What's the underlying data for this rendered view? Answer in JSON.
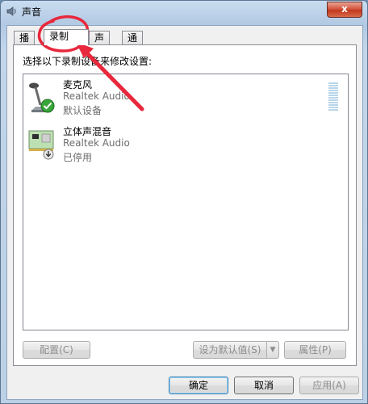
{
  "window": {
    "title": "声音",
    "close_glyph": "x"
  },
  "tabs": [
    {
      "label": "播放",
      "active": false
    },
    {
      "label": "录制",
      "active": true
    },
    {
      "label": "声音",
      "active": false
    },
    {
      "label": "通信",
      "active": false
    }
  ],
  "panel": {
    "instruction": "选择以下录制设备来修改设置:",
    "devices": [
      {
        "name": "麦克风",
        "driver": "Realtek Audio",
        "status": "默认设备",
        "icon": "microphone-icon",
        "badge": "default-check-icon"
      },
      {
        "name": "立体声混音",
        "driver": "Realtek Audio",
        "status": "已停用",
        "icon": "sound-card-icon",
        "badge": "disabled-arrow-icon"
      }
    ]
  },
  "panel_buttons": {
    "configure": "配置(C)",
    "set_default": "设为默认值(S)",
    "properties": "属性(P)"
  },
  "dialog_buttons": {
    "ok": "确定",
    "cancel": "取消",
    "apply": "应用(A)"
  },
  "colors": {
    "annotation": "#e8283c",
    "disabled_text": "#8d8d8d",
    "selection_highlight": "#b8d6ea"
  }
}
